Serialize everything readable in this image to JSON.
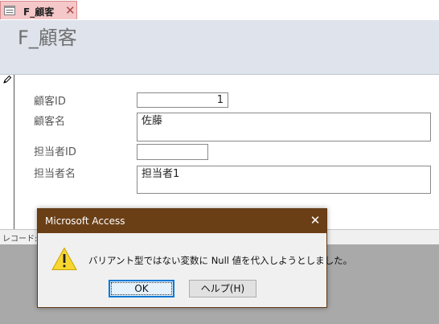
{
  "tab": {
    "label": "F_顧客",
    "icon": "form-icon",
    "close_glyph": "✕"
  },
  "form": {
    "title": "F_顧客",
    "header_bg": "#dfe3ec"
  },
  "fields": [
    {
      "label": "顧客ID",
      "value": "1"
    },
    {
      "label": "顧客名",
      "value": "佐藤"
    },
    {
      "label": "担当者ID",
      "value": ""
    },
    {
      "label": "担当者名",
      "value": "担当者1"
    }
  ],
  "navbar": {
    "label": "レコード:"
  },
  "dialog": {
    "title": "Microsoft Access",
    "close_glyph": "✕",
    "message": "バリアント型ではない変数に Null 値を代入しようとしました。",
    "ok_label": "OK",
    "help_label": "ヘルプ(H)",
    "titlebar_color": "#6b3f16",
    "icon": "warning-icon"
  }
}
